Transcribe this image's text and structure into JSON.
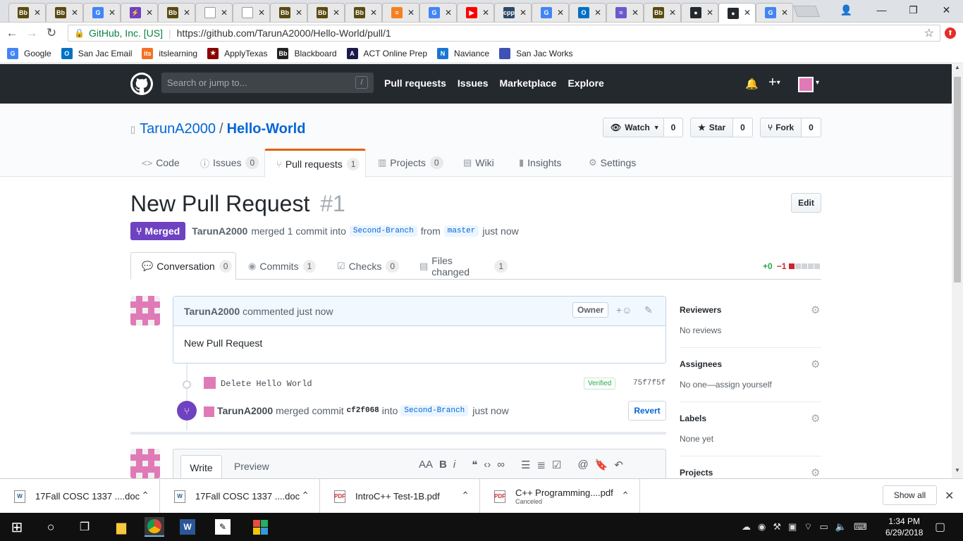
{
  "browser": {
    "tabs": [
      {
        "icon": "blackboard-icon",
        "label": "Bb",
        "color": "#5a4a10"
      },
      {
        "icon": "blackboard-icon",
        "label": "Bb",
        "color": "#5a4a10"
      },
      {
        "icon": "google-icon",
        "label": "G",
        "color": "#4285f4"
      },
      {
        "icon": "bolt-icon",
        "label": "⚡",
        "color": "#6f42c1"
      },
      {
        "icon": "blackboard-icon",
        "label": "Bb",
        "color": "#5a4a10"
      },
      {
        "icon": "document-icon",
        "label": "",
        "color": "#ffffff"
      },
      {
        "icon": "document-icon",
        "label": "",
        "color": "#ffffff"
      },
      {
        "icon": "blackboard-icon",
        "label": "Bb",
        "color": "#5a4a10"
      },
      {
        "icon": "blackboard-icon",
        "label": "Bb",
        "color": "#5a4a10"
      },
      {
        "icon": "blackboard-icon",
        "label": "Bb",
        "color": "#5a4a10"
      },
      {
        "icon": "stackoverflow-icon",
        "label": "≡",
        "color": "#f48024"
      },
      {
        "icon": "google-icon",
        "label": "G",
        "color": "#4285f4"
      },
      {
        "icon": "youtube-icon",
        "label": "▶",
        "color": "#ff0000"
      },
      {
        "icon": "cpp-icon",
        "label": "cpp",
        "color": "#2b4a6b"
      },
      {
        "icon": "google-icon",
        "label": "G",
        "color": "#4285f4"
      },
      {
        "icon": "outlook-icon",
        "label": "O",
        "color": "#0072c6"
      },
      {
        "icon": "waves-icon",
        "label": "≈",
        "color": "#6a5acd"
      },
      {
        "icon": "blackboard-icon",
        "label": "Bb",
        "color": "#5a4a10"
      },
      {
        "icon": "github-icon",
        "label": "●",
        "color": "#24292e"
      },
      {
        "icon": "github-icon",
        "label": "●",
        "color": "#24292e",
        "active": true
      },
      {
        "icon": "google-icon",
        "label": "G",
        "color": "#4285f4"
      }
    ],
    "security_label": "GitHub, Inc. [US]",
    "url": "https://github.com/TarunA2000/Hello-World/pull/1",
    "bookmarks": [
      {
        "label": "Google",
        "icon": "google-icon",
        "icon_text": "G",
        "color": "#4285f4"
      },
      {
        "label": "San Jac Email",
        "icon": "outlook-icon",
        "icon_text": "O",
        "color": "#0072c6"
      },
      {
        "label": "itslearning",
        "icon": "itslearning-icon",
        "icon_text": "its",
        "color": "#f37021"
      },
      {
        "label": "ApplyTexas",
        "icon": "star-icon",
        "icon_text": "★",
        "color": "#8b0000"
      },
      {
        "label": "Blackboard",
        "icon": "blackboard-icon",
        "icon_text": "Bb",
        "color": "#222222"
      },
      {
        "label": "ACT Online Prep",
        "icon": "act-icon",
        "icon_text": "A",
        "color": "#1a1a4a"
      },
      {
        "label": "Naviance",
        "icon": "naviance-icon",
        "icon_text": "N",
        "color": "#1976d2"
      },
      {
        "label": "San Jac Works",
        "icon": "sanjac-icon",
        "icon_text": "",
        "color": "#3f51b5"
      }
    ]
  },
  "gh": {
    "search_placeholder": "Search or jump to...",
    "search_key": "/",
    "nav": [
      "Pull requests",
      "Issues",
      "Marketplace",
      "Explore"
    ],
    "owner": "TarunA2000",
    "separator": "/",
    "repo": "Hello-World",
    "watch_label": "Watch",
    "watch_count": "0",
    "star_label": "Star",
    "star_count": "0",
    "fork_label": "Fork",
    "fork_count": "0",
    "tabs": [
      {
        "label": "Code",
        "icon": "<>",
        "count": ""
      },
      {
        "label": "Issues",
        "icon": "ⓘ",
        "count": "0"
      },
      {
        "label": "Pull requests",
        "icon": "⑂",
        "count": "1"
      },
      {
        "label": "Projects",
        "icon": "▥",
        "count": "0"
      },
      {
        "label": "Wiki",
        "icon": "▤",
        "count": ""
      },
      {
        "label": "Insights",
        "icon": "▮",
        "count": ""
      },
      {
        "label": "Settings",
        "icon": "⚙",
        "count": ""
      }
    ]
  },
  "pr": {
    "title": "New Pull Request",
    "number": "#1",
    "edit_label": "Edit",
    "state_label": "Merged",
    "author": "TarunA2000",
    "summary_text": "merged 1 commit into",
    "base_branch": "Second-Branch",
    "from_text": "from",
    "head_branch": "master",
    "time": "just now",
    "subtabs": [
      {
        "label": "Conversation",
        "count": "0"
      },
      {
        "label": "Commits",
        "count": "1"
      },
      {
        "label": "Checks",
        "count": "0"
      },
      {
        "label": "Files changed",
        "count": "1"
      }
    ],
    "additions": "+0",
    "deletions": "−1",
    "comment": {
      "author": "TarunA2000",
      "meta": "commented just now",
      "owner_label": "Owner",
      "body": "New Pull Request"
    },
    "commit": {
      "message": "Delete Hello World",
      "verified": "Verified",
      "sha": "75f7f5f"
    },
    "merge_event": {
      "author": "TarunA2000",
      "text": "merged commit",
      "sha": "cf2f068",
      "into": "into",
      "branch": "Second-Branch",
      "time": "just now",
      "revert_label": "Revert"
    },
    "editor": {
      "write_label": "Write",
      "preview_label": "Preview"
    },
    "sidebar": [
      {
        "heading": "Reviewers",
        "value": "No reviews"
      },
      {
        "heading": "Assignees",
        "value": "No one—assign yourself"
      },
      {
        "heading": "Labels",
        "value": "None yet"
      },
      {
        "heading": "Projects",
        "value": ""
      }
    ]
  },
  "downloads": {
    "items": [
      {
        "name": "17Fall COSC 1337 ....doc",
        "sub": "",
        "type": "W"
      },
      {
        "name": "17Fall COSC 1337 ....doc",
        "sub": "",
        "type": "W"
      },
      {
        "name": "IntroC++ Test-1B.pdf",
        "sub": "",
        "type": "PDF"
      },
      {
        "name": "C++ Programming....pdf",
        "sub": "Canceled",
        "type": "PDF"
      }
    ],
    "show_all": "Show all"
  },
  "taskbar": {
    "time": "1:34 PM",
    "date": "6/29/2018"
  }
}
